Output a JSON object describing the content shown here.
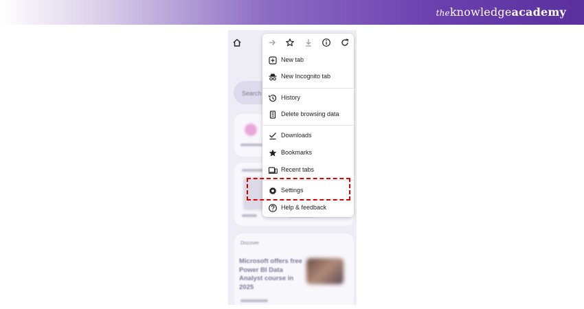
{
  "brand": {
    "prefix": "the",
    "name_light": "knowledge",
    "name_bold": "academy"
  },
  "background": {
    "search_placeholder": "Search",
    "discover_label": "Discover",
    "article_title": "Microsoft offers free Power BI Data Analyst course in 2025"
  },
  "menu": {
    "toolbar": [
      {
        "icon": "forward-arrow-icon",
        "enabled": false
      },
      {
        "icon": "bookmark-star-icon",
        "enabled": true
      },
      {
        "icon": "download-icon",
        "enabled": false
      },
      {
        "icon": "page-info-icon",
        "enabled": true
      },
      {
        "icon": "refresh-icon",
        "enabled": true
      }
    ],
    "items": [
      {
        "label": "New tab",
        "icon": "new-tab-icon"
      },
      {
        "label": "New Incognito tab",
        "icon": "incognito-icon"
      },
      {
        "label": "History",
        "icon": "history-icon"
      },
      {
        "label": "Delete browsing data",
        "icon": "trash-icon"
      },
      {
        "label": "Downloads",
        "icon": "downloads-check-icon"
      },
      {
        "label": "Bookmarks",
        "icon": "star-icon"
      },
      {
        "label": "Recent tabs",
        "icon": "recent-tabs-icon"
      },
      {
        "label": "Settings",
        "icon": "gear-icon"
      },
      {
        "label": "Help & feedback",
        "icon": "help-icon"
      }
    ]
  },
  "colors": {
    "highlight": "#e00000",
    "banner": "#5a2f9e"
  }
}
